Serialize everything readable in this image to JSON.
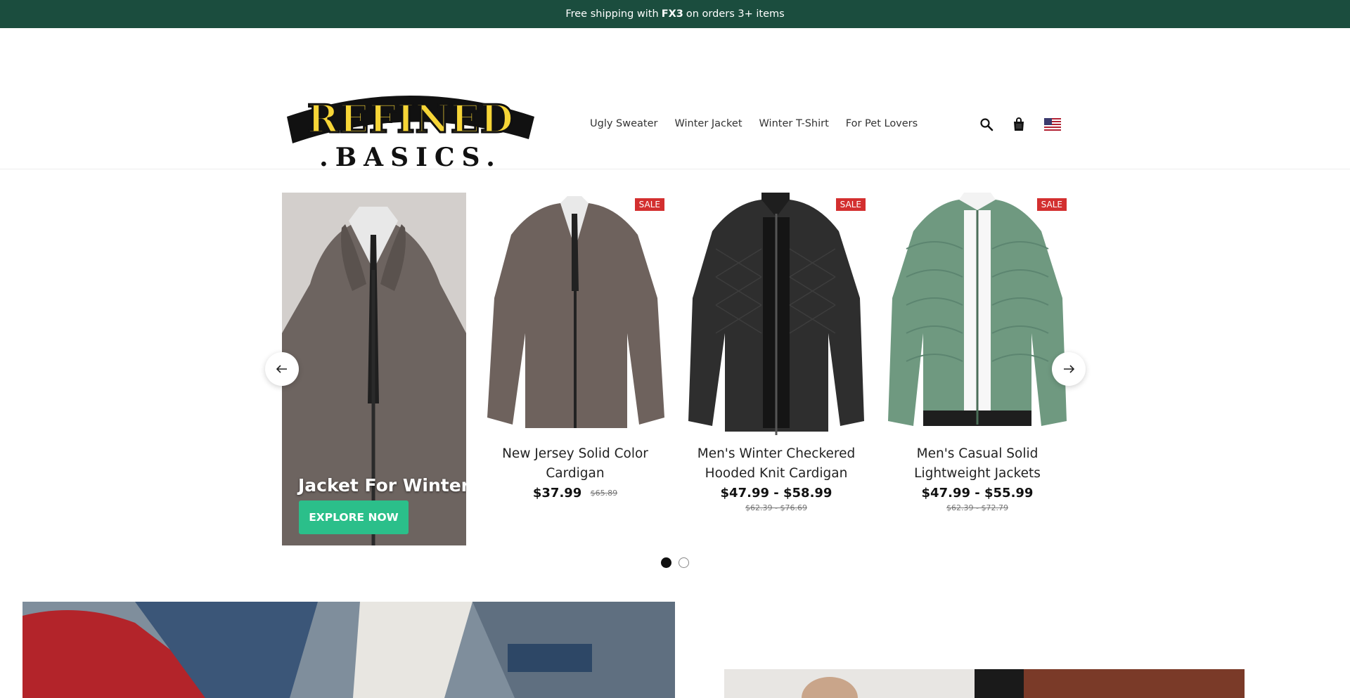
{
  "announcement": {
    "prefix": "Free shipping with",
    "code": "FX3",
    "suffix": "on orders 3+ items"
  },
  "logo": {
    "line1": "REFINED",
    "line2": ".BASICS."
  },
  "nav": {
    "items": [
      "Ugly Sweater",
      "Winter Jacket",
      "Winter T-Shirt",
      "For Pet Lovers"
    ]
  },
  "header_icons": [
    "search-icon",
    "cart-icon",
    "us-flag-icon"
  ],
  "promo": {
    "title": "Jacket For Winter",
    "button": "EXPLORE NOW"
  },
  "products": [
    {
      "title": "New Jersey Solid Color Cardigan",
      "price": "$37.99",
      "compare": "$65.89",
      "badge": "SALE"
    },
    {
      "title": "Men's Winter Checkered Hooded Knit Cardigan",
      "price": "$47.99 - $58.99",
      "compare": "$62.39 - $76.69",
      "badge": "SALE"
    },
    {
      "title": "Men's Casual Solid Lightweight Jackets",
      "price": "$47.99 - $55.99",
      "compare": "$62.39 - $72.79",
      "badge": "SALE"
    }
  ],
  "carousel": {
    "slide_count": 2,
    "active_slide": 1
  },
  "colors": {
    "announcement_bg": "#1b4d3e",
    "button": "#2bbf8a",
    "sale_badge": "#d32f2f",
    "logo_yellow": "#f6d537"
  }
}
